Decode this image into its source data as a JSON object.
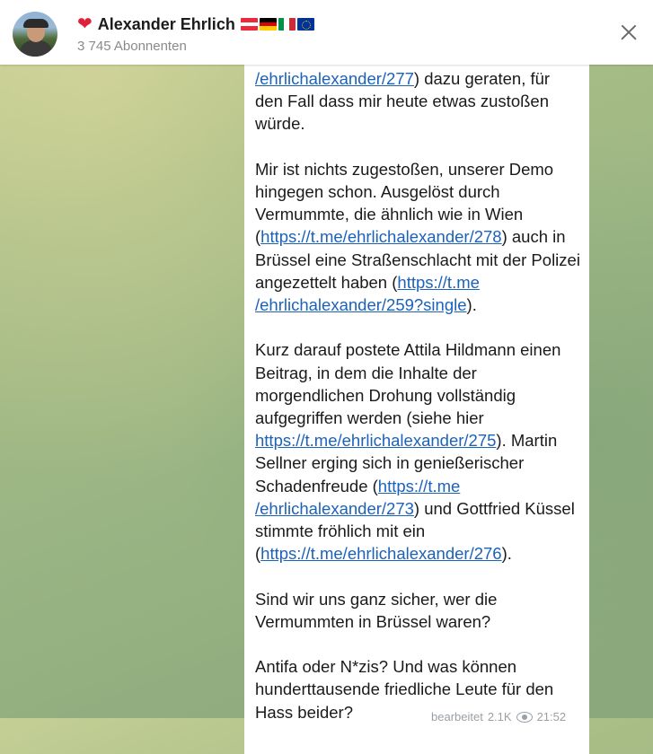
{
  "header": {
    "channel_name": "Alexander Ehrlich",
    "subscribers": "3 745 Abonnenten",
    "icons": [
      "heart-icon",
      "flag-at-icon",
      "flag-de-icon",
      "flag-it-icon",
      "flag-eu-icon",
      "close-icon"
    ]
  },
  "message": {
    "p1_link": "/ehrlichalexander/277",
    "p1_text": ") dazu geraten, für den Fall dass mir heute etwas zustoßen würde.",
    "p2_a": "Mir ist nichts zugestoßen, unserer Demo hingegen schon. Ausgelöst durch Vermummte, die ähnlich wie in Wien (",
    "p2_link1": "https://t.me/ehrlichalexander/278",
    "p2_b": ") auch in Brüssel eine Straßenschlacht mit der Polizei angezettelt haben (",
    "p2_link2a": "https://t.me",
    "p2_link2b": "/ehrlichalexander/259?single",
    "p2_c": ").",
    "p3_a": "Kurz darauf postete Attila Hildmann einen Beitrag, in dem die Inhalte der morgendlichen Drohung vollständig aufgegriffen werden (siehe hier ",
    "p3_link1": "https://t.me/ehrlichalexander/275",
    "p3_b": "). Martin Sellner erging sich in genießerischer Schadenfreude (",
    "p3_link2a": "https://t.me",
    "p3_link2b": "/ehrlichalexander/273",
    "p3_c": ") und Gottfried Küssel stimmte fröhlich mit ein (",
    "p3_link3": "https://t.me/ehrlichalexander/276",
    "p3_d": ").",
    "p4": "Sind wir uns ganz sicher, wer die Vermummten in Brüssel waren?",
    "p5": "Antifa oder N*zis? Und was können hunderttausende friedliche Leute für den Hass beider?"
  },
  "meta": {
    "edited": "bearbeitet",
    "views": "2.1K",
    "time": "21:52"
  }
}
